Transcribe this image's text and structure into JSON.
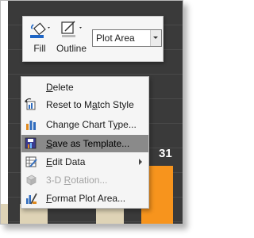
{
  "toolbar": {
    "fill_label": "Fill",
    "outline_label": "Outline",
    "element_selector": {
      "value": "Plot Area"
    }
  },
  "context_menu": {
    "items": [
      {
        "pre": "",
        "key": "D",
        "post": "elete",
        "icon": "none",
        "state": "normal"
      },
      {
        "pre": "Reset to M",
        "key": "a",
        "post": "tch Style",
        "icon": "reset-style-icon",
        "state": "normal"
      },
      {
        "pre": "Change Chart T",
        "key": "y",
        "post": "pe...",
        "icon": "change-chart-type-icon",
        "state": "normal"
      },
      {
        "pre": "",
        "key": "S",
        "post": "ave as Template...",
        "icon": "save-template-icon",
        "state": "highlighted"
      },
      {
        "pre": "",
        "key": "E",
        "post": "dit Data",
        "icon": "edit-data-icon",
        "state": "normal",
        "submenu": true
      },
      {
        "pre": "3-D ",
        "key": "R",
        "post": "otation...",
        "icon": "3d-rotation-icon",
        "state": "disabled"
      },
      {
        "pre": "",
        "key": "F",
        "post": "ormat Plot Area...",
        "icon": "format-plot-area-icon",
        "state": "normal"
      }
    ]
  },
  "chart": {
    "data_label": "31",
    "colors": {
      "plot_area": "#3a3a3a",
      "bar_beige": "#ded3b6",
      "bar_orange": "#f7941d"
    }
  }
}
